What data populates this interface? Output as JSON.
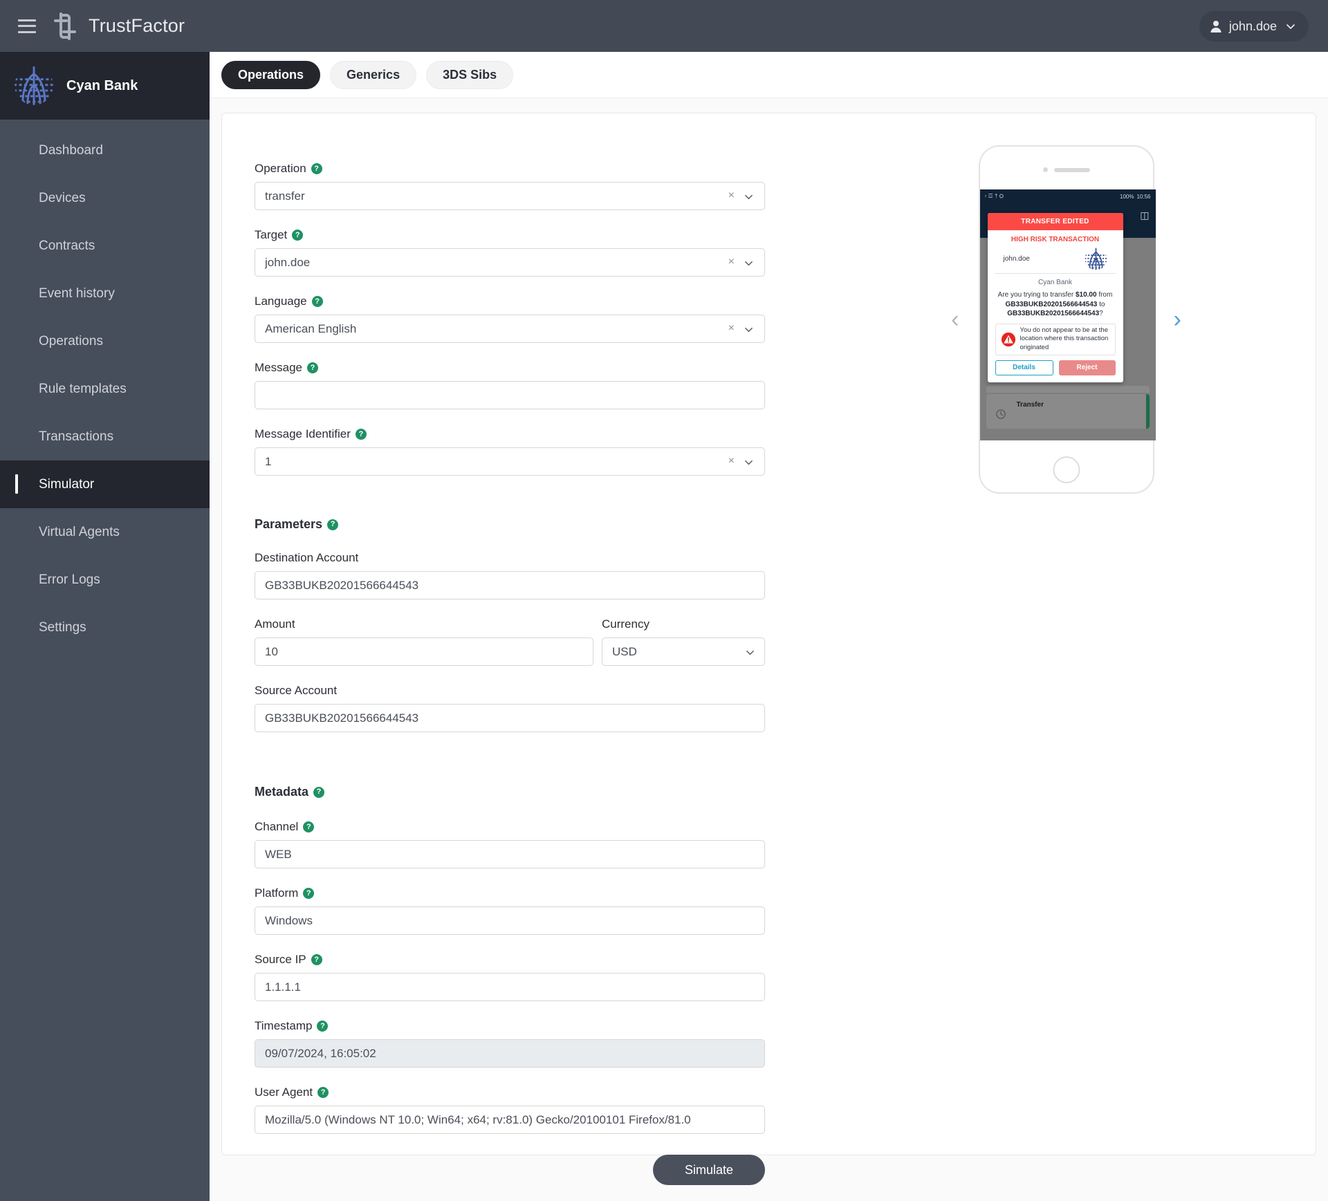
{
  "header": {
    "menu_icon": "hamburger-icon",
    "logo_icon": "trustfactor-logo-icon",
    "app_title": "TrustFactor",
    "user": {
      "avatar_icon": "user-avatar-icon",
      "name": "john.doe",
      "chevron_icon": "chevron-down-icon"
    }
  },
  "sidebar": {
    "brand": {
      "logo_icon": "cyan-bank-logo-icon",
      "name": "Cyan Bank"
    },
    "items": [
      {
        "label": "Dashboard",
        "active": false
      },
      {
        "label": "Devices",
        "active": false
      },
      {
        "label": "Contracts",
        "active": false
      },
      {
        "label": "Event history",
        "active": false
      },
      {
        "label": "Operations",
        "active": false
      },
      {
        "label": "Rule templates",
        "active": false
      },
      {
        "label": "Transactions",
        "active": false
      },
      {
        "label": "Simulator",
        "active": true
      },
      {
        "label": "Virtual Agents",
        "active": false
      },
      {
        "label": "Error Logs",
        "active": false
      },
      {
        "label": "Settings",
        "active": false
      }
    ]
  },
  "tabs": [
    {
      "label": "Operations",
      "active": true
    },
    {
      "label": "Generics",
      "active": false
    },
    {
      "label": "3DS Sibs",
      "active": false
    }
  ],
  "form": {
    "operation": {
      "label": "Operation",
      "value": "transfer",
      "help": "?",
      "clear": "×"
    },
    "target": {
      "label": "Target",
      "value": "john.doe",
      "help": "?",
      "clear": "×"
    },
    "language": {
      "label": "Language",
      "value": "American English",
      "help": "?",
      "clear": "×"
    },
    "message": {
      "label": "Message",
      "value": "",
      "placeholder": "",
      "help": "?"
    },
    "message_identifier": {
      "label": "Message Identifier",
      "value": "1",
      "help": "?",
      "clear": "×"
    },
    "parameters_section": {
      "label": "Parameters",
      "help": "?"
    },
    "destination_account": {
      "label": "Destination Account",
      "value": "GB33BUKB20201566644543"
    },
    "amount": {
      "label": "Amount",
      "value": "10"
    },
    "currency": {
      "label": "Currency",
      "value": "USD",
      "options": [
        "USD"
      ]
    },
    "source_account": {
      "label": "Source Account",
      "value": "GB33BUKB20201566644543"
    },
    "metadata_section": {
      "label": "Metadata",
      "help": "?"
    },
    "channel": {
      "label": "Channel",
      "value": "WEB",
      "help": "?"
    },
    "platform": {
      "label": "Platform",
      "value": "Windows",
      "help": "?"
    },
    "source_ip": {
      "label": "Source IP",
      "value": "1.1.1.1",
      "help": "?"
    },
    "timestamp": {
      "label": "Timestamp",
      "value": "09/07/2024, 16:05:02",
      "help": "?"
    },
    "user_agent": {
      "label": "User Agent",
      "value": "Mozilla/5.0 (Windows NT 10.0; Win64; x64; rv:81.0) Gecko/20100101 Firefox/81.0",
      "help": "?"
    },
    "simulate_button": "Simulate"
  },
  "preview": {
    "prev_arrow_icon": "chevron-left-icon",
    "next_arrow_icon": "chevron-right-icon",
    "phone": {
      "status_bar": {
        "left_icons": "▫ ☲ † ⛭",
        "battery": "100%",
        "time": "10:56"
      },
      "modal": {
        "title": "TRANSFER EDITED",
        "subtitle": "HIGH RISK TRANSACTION",
        "username": "john.doe",
        "bank_logo_icon": "cyan-bank-logo-icon",
        "bank_name": "Cyan Bank",
        "body_prefix": "Are you trying to transfer ",
        "amount": "$10.00",
        "body_from": " from ",
        "source_account": "GB33BUKB20201566644543",
        "body_to": " to ",
        "destination_account": "GB33BUKB20201566644543",
        "body_suffix": "?",
        "warning_icon": "alert-triangle-icon",
        "warning_text": "You do not appear to be at the location where this transaction originated",
        "details_button": "Details",
        "reject_button": "Reject"
      },
      "background_item": {
        "title": "Transfer",
        "clock_icon": "clock-icon"
      }
    }
  },
  "colors": {
    "topbar": "#434a56",
    "sidebar": "#474e5b",
    "sidebar_active": "#23262e",
    "help_green": "#1f9163",
    "alert_red": "#fb4a46",
    "accent_blue": "#4e9ed6"
  }
}
